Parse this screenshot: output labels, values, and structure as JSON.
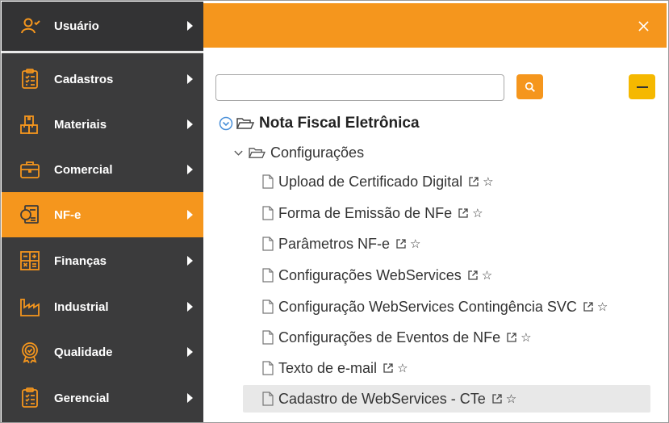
{
  "sidebar": {
    "user": {
      "label": "Usuário",
      "icon": "user-icon"
    },
    "items": [
      {
        "label": "Cadastros",
        "icon": "clipboard-icon"
      },
      {
        "label": "Materiais",
        "icon": "boxes-icon"
      },
      {
        "label": "Comercial",
        "icon": "briefcase-icon"
      },
      {
        "label": "NF-e",
        "icon": "invoice-icon"
      },
      {
        "label": "Finanças",
        "icon": "calculator-icon"
      },
      {
        "label": "Industrial",
        "icon": "factory-icon"
      },
      {
        "label": "Qualidade",
        "icon": "badge-icon"
      },
      {
        "label": "Gerencial",
        "icon": "clipboard-icon"
      }
    ],
    "active_item": "NF-e"
  },
  "search": {
    "value": "",
    "placeholder": ""
  },
  "tree": {
    "root_label": "Nota Fiscal Eletrônica",
    "group_label": "Configurações",
    "leaves": [
      "Upload de Certificado Digital",
      "Forma de Emissão de NFe",
      "Parâmetros NF-e",
      "Configurações WebServices",
      "Configuração WebServices Contingência SVC",
      "Configurações de Eventos de NFe",
      "Texto de e-mail",
      "Cadastro de WebServices - CTe"
    ]
  },
  "colors": {
    "accent": "#f5961d",
    "sidebar": "#3b3b3c",
    "collapse": "#f5b800"
  }
}
